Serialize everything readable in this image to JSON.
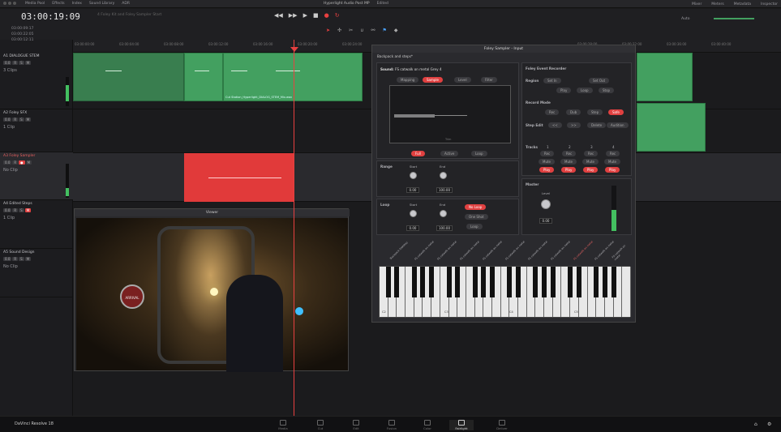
{
  "menubar": {
    "items": [
      "Media Pool",
      "Effects",
      "Index",
      "Sound Library",
      "ADR"
    ],
    "center_title": "Hyperlight Audio Post MP",
    "center_status": "Edited",
    "right_items": [
      "Mixer",
      "Meters",
      "Metadata",
      "Inspector"
    ]
  },
  "transport": {
    "timecode": "03:00:19:09",
    "timeline_name": "4 Foley Kit and Foley Sampler Start",
    "tc_lines": [
      "03:00:09:17",
      "03:00:22:05",
      "03:00:12:11"
    ],
    "auto_label": "Auto"
  },
  "ruler": {
    "ticks": [
      "03:00:00:00",
      "03:00:04:00",
      "03:00:08:00",
      "03:00:12:00",
      "03:00:16:00",
      "03:00:20:00",
      "03:00:24:00",
      "03:00:28:00",
      "03:00:32:00",
      "03:00:36:00",
      "03:00:40:00"
    ]
  },
  "tracks": [
    {
      "id": "A1",
      "name": "DIALOGUE STEM",
      "level": "1.0",
      "vol": "0.0",
      "clips": "3 Clips"
    },
    {
      "id": "A2",
      "name": "Foley SFX",
      "level": "1.0",
      "vol": "0.0",
      "clips": "1 Clip"
    },
    {
      "id": "A3",
      "name": "Foley Sampler",
      "level": "1.0",
      "vol": "0.0",
      "clips": "No Clip"
    },
    {
      "id": "A4",
      "name": "Edited Steps",
      "level": "1.0",
      "vol": "0.0",
      "clips": "1 Clip"
    },
    {
      "id": "A5",
      "name": "Sound Design",
      "level": "1.0",
      "vol": "0.0",
      "clips": "No Clip"
    }
  ],
  "clip_labels": {
    "a1_left": "Cut Station_Hyperlight_DIALOG_STEM_Mix.wav",
    "a1_mid": "Cut Station_Hyperlight_DIALOG_STEM_Mix.wav"
  },
  "viewer": {
    "title": "Viewer",
    "sign_text": "ARRIVAL"
  },
  "sampler": {
    "title": "Foley Sampler - Input",
    "preset": "Backpack and steps*",
    "sound_label": "Sound:",
    "sound_name": "FS catwalk on metal Grey 4",
    "tabs": [
      "Mapping",
      "Sample",
      "Level",
      "Filter"
    ],
    "wave_footer": "Trim",
    "modes": [
      "Full",
      "Active",
      "Loop"
    ],
    "range": {
      "label": "Range",
      "start_label": "Start",
      "end_label": "End",
      "start_val": "0.00",
      "end_val": "100.00"
    },
    "loop": {
      "label": "Loop",
      "start_label": "Start",
      "end_label": "End",
      "start_val": "0.00",
      "end_val": "100.00",
      "modes": [
        "No Loop",
        "One Shot",
        "Loop"
      ]
    },
    "recorder": {
      "title": "Foley Event Recorder",
      "region_label": "Region",
      "region_btns": [
        "Set In",
        "Set Out"
      ],
      "transport_btns": [
        "Play",
        "Loop",
        "Stop"
      ],
      "record_mode_label": "Record Mode",
      "record_modes": [
        "Rec",
        "Dub",
        "Step",
        "Safe"
      ],
      "step_edit_label": "Step Edit",
      "step_btns": [
        "<<",
        ">>",
        "Delete",
        "Audition"
      ],
      "tracks_label": "Tracks",
      "track_nums": [
        "1",
        "2",
        "3",
        "4"
      ],
      "track_rows": [
        "Rec",
        "Mute",
        "Play"
      ]
    },
    "master": {
      "title": "Master",
      "level_label": "Level",
      "level_val": "0.00"
    },
    "key_labels": [
      "Backpack footstep",
      "FS catwalk on metal",
      "FS catwalk on metal",
      "FS catwalk on metal",
      "FS catwalk on metal",
      "FS catwalk on metal",
      "FS catwalk on metal",
      "FS catwalk on metal",
      "FS catwalk on metal",
      "FS catwalk on metal",
      "FS catwalk on metal"
    ],
    "octaves": [
      "C2",
      "C3",
      "C4",
      "C5"
    ]
  },
  "pages": [
    "Media",
    "Cut",
    "Edit",
    "Fusion",
    "Color",
    "Fairlight",
    "Deliver"
  ],
  "app_name": "DaVinci Resolve 18"
}
